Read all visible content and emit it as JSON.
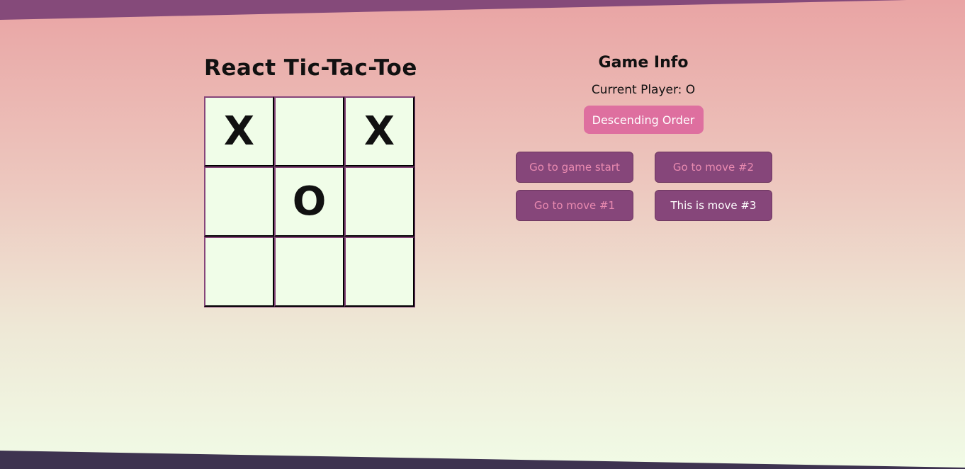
{
  "page": {
    "title": "React Tic-Tac-Toe"
  },
  "board": {
    "squares": [
      "X",
      "",
      "X",
      "",
      "O",
      "",
      "",
      "",
      ""
    ]
  },
  "info": {
    "heading": "Game Info",
    "current_player": "Current Player: O",
    "order_button": "Descending Order"
  },
  "moves": [
    {
      "label": "Go to game start",
      "current": false
    },
    {
      "label": "Go to move #1",
      "current": false
    },
    {
      "label": "Go to move #2",
      "current": false
    },
    {
      "label": "This is move #3",
      "current": true
    }
  ],
  "colors": {
    "board_border": "#86457a",
    "square_bg": "#f0fde8",
    "order_button_bg": "#de6f9f",
    "move_button_bg": "#86467a",
    "move_button_text": "#e98ab0",
    "current_move_text": "#ffffff",
    "top_band": "#854a7a",
    "bottom_band": "#3e3350"
  }
}
